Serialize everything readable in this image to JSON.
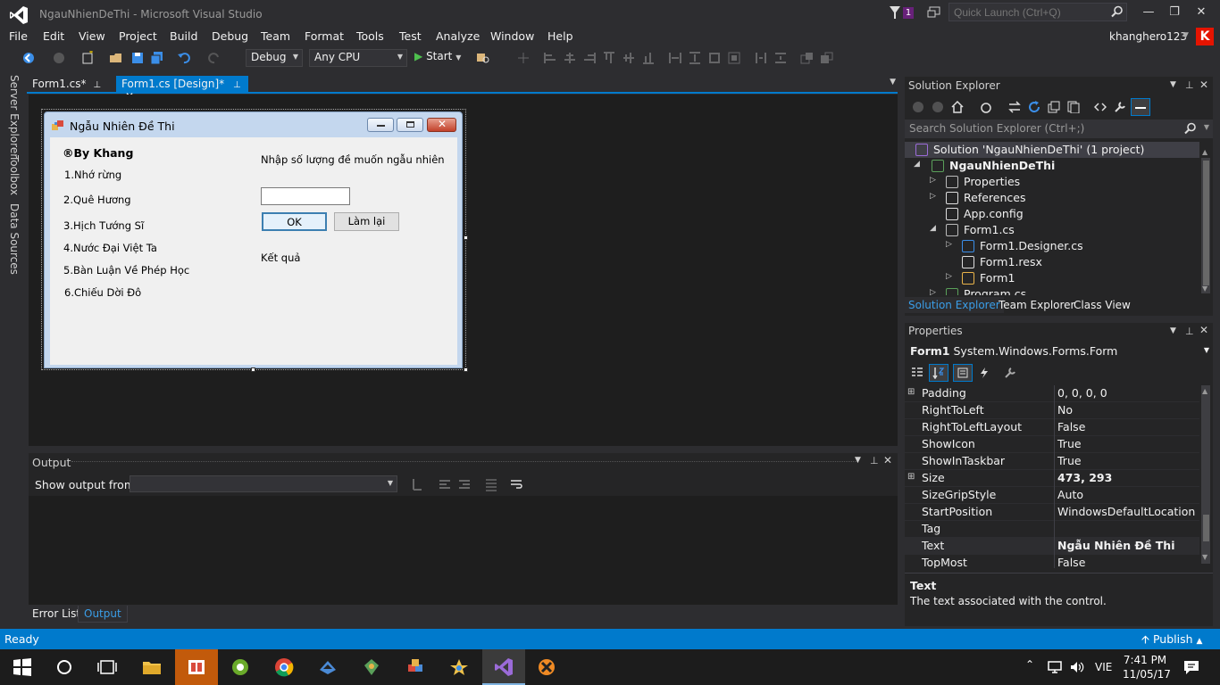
{
  "window": {
    "title": "NgauNhienDeThi - Microsoft Visual Studio",
    "notification_count": "1",
    "quick_launch_placeholder": "Quick Launch (Ctrl+Q)"
  },
  "menu": [
    "File",
    "Edit",
    "View",
    "Project",
    "Build",
    "Debug",
    "Team",
    "Format",
    "Tools",
    "Test",
    "Analyze",
    "Window",
    "Help"
  ],
  "user": {
    "name": "khanghero123",
    "avatar_letter": "K"
  },
  "toolbar": {
    "config": "Debug",
    "platform": "Any CPU",
    "start_label": "Start"
  },
  "left_rail": [
    "Server Explorer",
    "Toolbox",
    "Data Sources"
  ],
  "doc_tabs": [
    {
      "label": "Form1.cs*"
    },
    {
      "label": "Form1.cs [Design]*"
    }
  ],
  "form": {
    "title": "Ngẫu Nhiên Đề Thi",
    "author": "®By Khang",
    "items": [
      "1.Nhớ rừng",
      "2.Quê Hương",
      "3.Hịch Tướng Sĩ",
      "4.Nước Đại Việt Ta",
      "5.Bàn Luận Về Phép Học",
      "6.Chiếu Dời Đô"
    ],
    "prompt": "Nhập số lượng đề muốn ngẫu nhiên",
    "ok_label": "OK",
    "reset_label": "Làm lại",
    "result_label": "Kết quả"
  },
  "output": {
    "title": "Output",
    "show_from_label": "Show output from:"
  },
  "bottom_tabs": [
    "Error List",
    "Output"
  ],
  "solution_explorer": {
    "title": "Solution Explorer",
    "search_placeholder": "Search Solution Explorer (Ctrl+;)",
    "tree": [
      {
        "label": "Solution 'NgauNhienDeThi' (1 project)",
        "level": 0,
        "arrow": "",
        "icon": "solution-icon"
      },
      {
        "label": "NgauNhienDeThi",
        "level": 1,
        "arrow": "◢",
        "icon": "csharp-project-icon",
        "bold": true
      },
      {
        "label": "Properties",
        "level": 2,
        "arrow": "▷",
        "icon": "wrench-icon"
      },
      {
        "label": "References",
        "level": 2,
        "arrow": "▷",
        "icon": "references-icon"
      },
      {
        "label": "App.config",
        "level": 2,
        "arrow": "",
        "icon": "config-icon"
      },
      {
        "label": "Form1.cs",
        "level": 2,
        "arrow": "◢",
        "icon": "form-icon"
      },
      {
        "label": "Form1.Designer.cs",
        "level": 3,
        "arrow": "▷",
        "icon": "designer-file-icon"
      },
      {
        "label": "Form1.resx",
        "level": 3,
        "arrow": "",
        "icon": "resx-icon"
      },
      {
        "label": "Form1",
        "level": 3,
        "arrow": "▷",
        "icon": "class-icon"
      },
      {
        "label": "Program.cs",
        "level": 2,
        "arrow": "▷",
        "icon": "csharp-file-icon"
      }
    ],
    "tabs": [
      "Solution Explorer",
      "Team Explorer",
      "Class View"
    ]
  },
  "properties": {
    "title": "Properties",
    "object_name": "Form1",
    "object_type": "System.Windows.Forms.Form",
    "rows": [
      {
        "name": "Padding",
        "value": "0, 0, 0, 0",
        "expand": true,
        "bold": false
      },
      {
        "name": "RightToLeft",
        "value": "No",
        "expand": false,
        "bold": false
      },
      {
        "name": "RightToLeftLayout",
        "value": "False",
        "expand": false,
        "bold": false
      },
      {
        "name": "ShowIcon",
        "value": "True",
        "expand": false,
        "bold": false
      },
      {
        "name": "ShowInTaskbar",
        "value": "True",
        "expand": false,
        "bold": false
      },
      {
        "name": "Size",
        "value": "473, 293",
        "expand": true,
        "bold": true
      },
      {
        "name": "SizeGripStyle",
        "value": "Auto",
        "expand": false,
        "bold": false
      },
      {
        "name": "StartPosition",
        "value": "WindowsDefaultLocation",
        "expand": false,
        "bold": false
      },
      {
        "name": "Tag",
        "value": "",
        "expand": false,
        "bold": false
      },
      {
        "name": "Text",
        "value": "Ngẫu Nhiên Đề Thi",
        "expand": false,
        "bold": true
      },
      {
        "name": "TopMost",
        "value": "False",
        "expand": false,
        "bold": false
      }
    ],
    "desc_title": "Text",
    "desc_body": "The text associated with the control."
  },
  "status": {
    "text": "Ready",
    "publish": "Publish"
  },
  "taskbar": {
    "lang": "VIE",
    "time": "7:41 PM",
    "date": "11/05/17"
  },
  "colors": {
    "accent": "#007acc",
    "background": "#2d2d30",
    "editor": "#1e1e1e"
  }
}
